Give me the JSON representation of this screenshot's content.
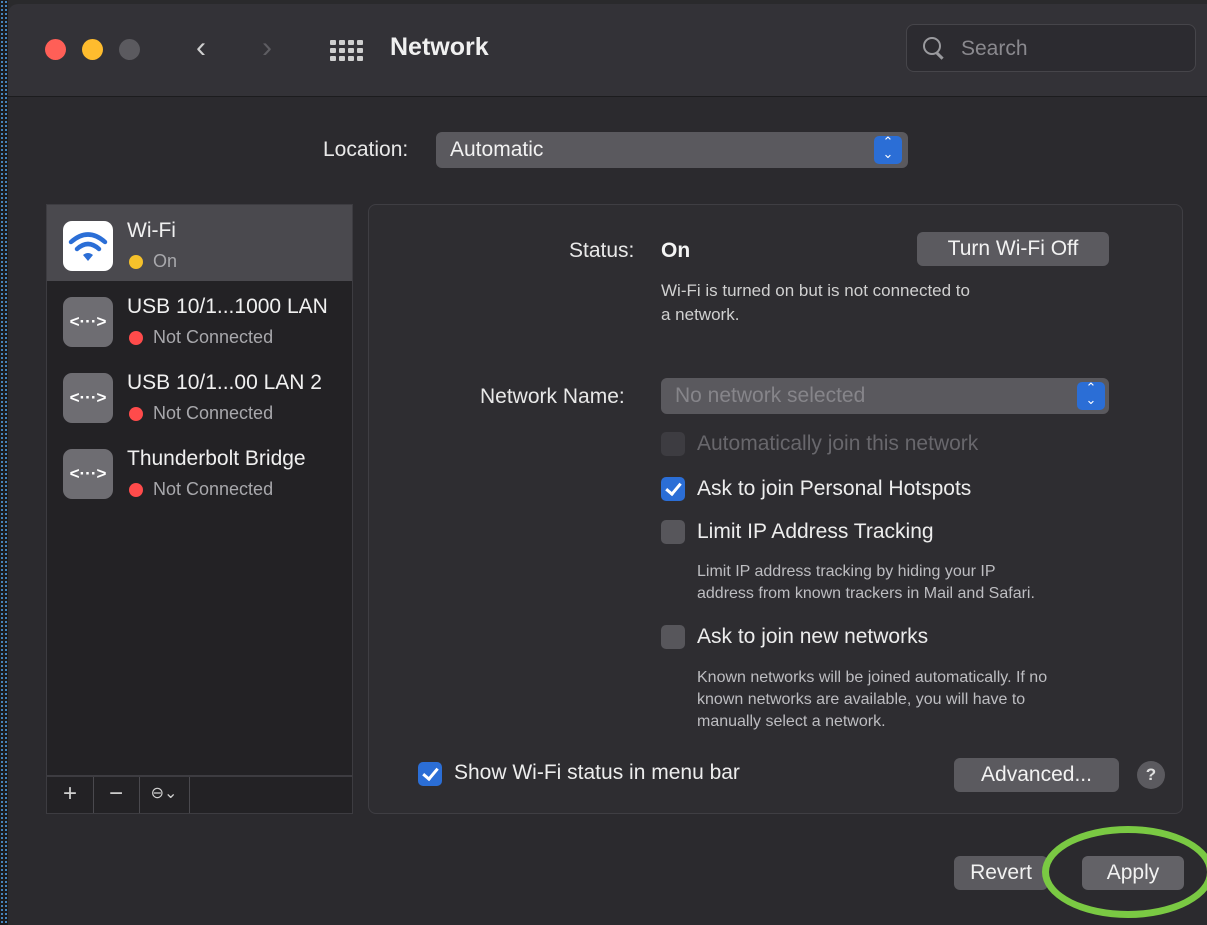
{
  "window": {
    "title": "Network",
    "search_placeholder": "Search"
  },
  "location": {
    "label": "Location:",
    "value": "Automatic"
  },
  "services": [
    {
      "name": "Wi-Fi",
      "status": "On",
      "status_color": "#f5c12b",
      "icon": "wifi-icon",
      "selected": true
    },
    {
      "name": "USB 10/1...1000 LAN",
      "status": "Not Connected",
      "status_color": "#ff4b4b",
      "icon": "ethernet-icon"
    },
    {
      "name": "USB 10/1...00 LAN 2",
      "status": "Not Connected",
      "status_color": "#ff4b4b",
      "icon": "ethernet-icon"
    },
    {
      "name": "Thunderbolt Bridge",
      "status": "Not Connected",
      "status_color": "#ff4b4b",
      "icon": "ethernet-icon"
    }
  ],
  "sidebar_footer": {
    "add": "+",
    "remove": "−",
    "action": "⊖⌄"
  },
  "panel": {
    "status_label": "Status:",
    "status_value": "On",
    "turn_off_button": "Turn Wi-Fi Off",
    "status_desc_1": "Wi-Fi is turned on but is not connected to",
    "status_desc_2": "a network.",
    "network_name_label": "Network Name:",
    "network_name_placeholder": "No network selected",
    "auto_join": "Automatically join this network",
    "ask_hotspots": "Ask to join Personal Hotspots",
    "limit_ip": "Limit IP Address Tracking",
    "limit_ip_desc_1": "Limit IP address tracking by hiding your IP",
    "limit_ip_desc_2": "address from known trackers in Mail and Safari.",
    "ask_new": "Ask to join new networks",
    "ask_new_desc_1": "Known networks will be joined automatically. If no",
    "ask_new_desc_2": "known networks are available, you will have to",
    "ask_new_desc_3": "manually select a network.",
    "show_status": "Show Wi-Fi status in menu bar",
    "advanced_button": "Advanced...",
    "help": "?"
  },
  "footer": {
    "revert": "Revert",
    "apply": "Apply"
  },
  "colors": {
    "accent": "#2b6ed6",
    "highlight_ring": "#7ac943"
  }
}
